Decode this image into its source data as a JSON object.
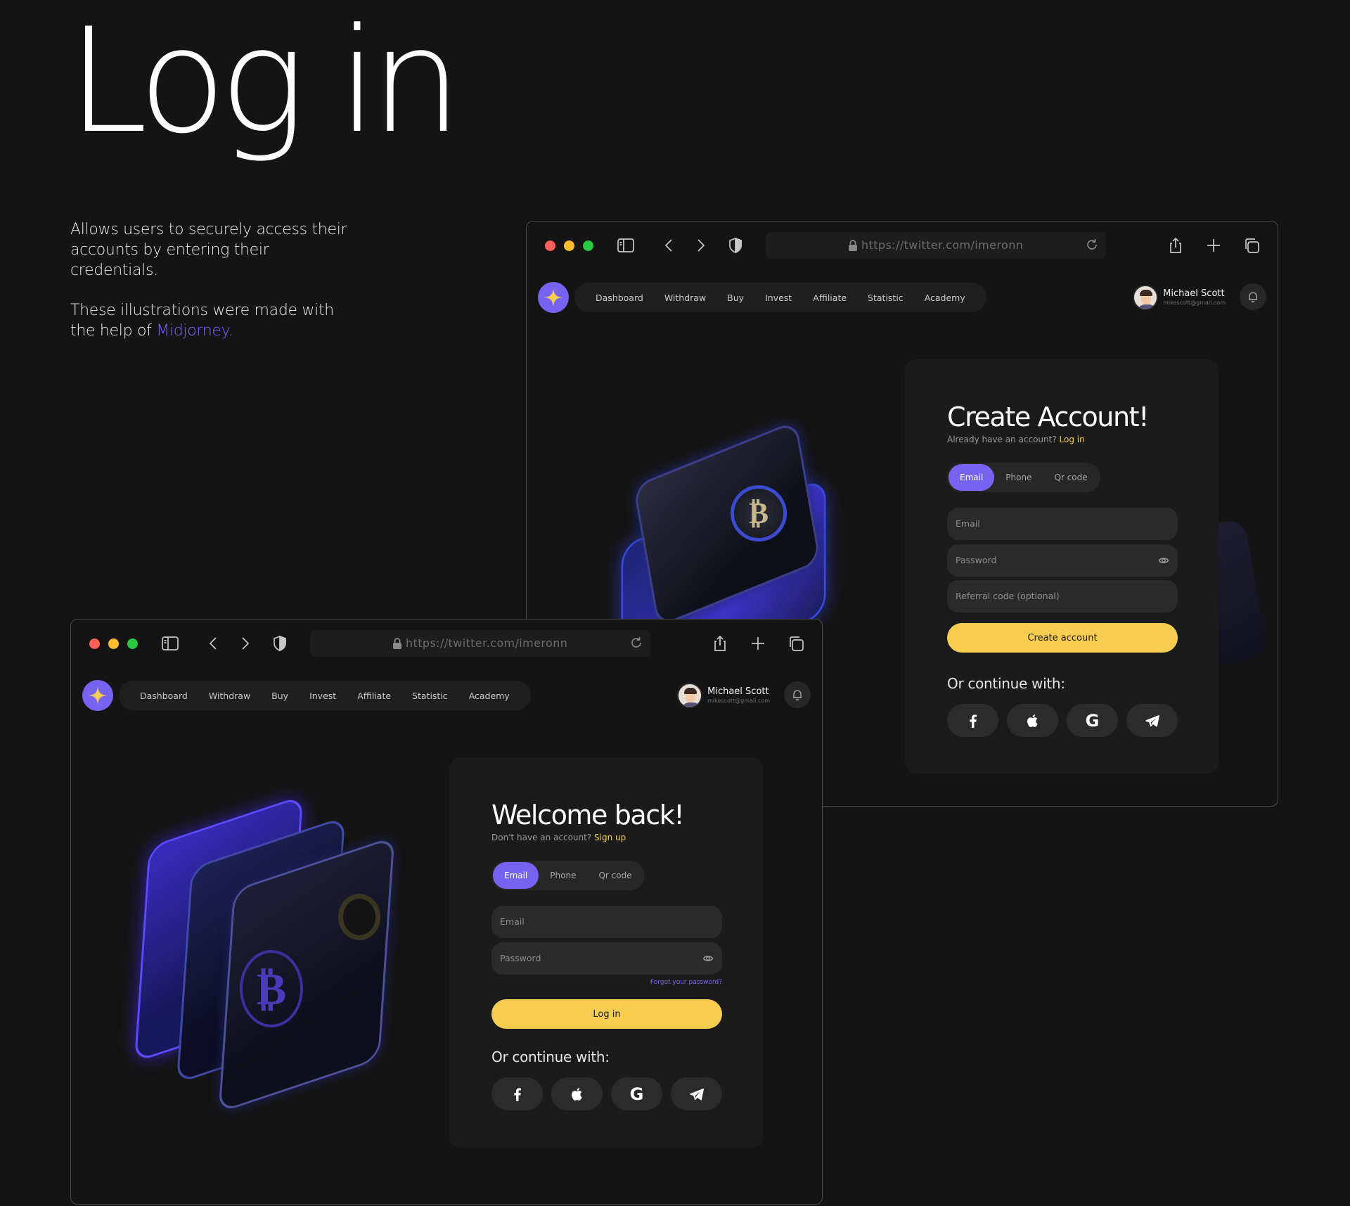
{
  "intro": {
    "title": "Log in",
    "desc": "Allows users to securely access their accounts by entering their credentials.",
    "credit_prefix": "These illustrations were made with the help of",
    "credit_link": "Midjorney."
  },
  "browser": {
    "url": "https://twitter.com/imeronn",
    "nav": [
      "Dashboard",
      "Withdraw",
      "Buy",
      "Invest",
      "Affiliate",
      "Statistic",
      "Academy"
    ],
    "user_name": "Michael Scott",
    "user_email": "mikescott@gmail.com"
  },
  "signup": {
    "title": "Create Account!",
    "subtitle": "Already have an account?",
    "subtitle_link": "Log in",
    "tabs": [
      "Email",
      "Phone",
      "Qr code"
    ],
    "active_tab": "Email",
    "email_placeholder": "Email",
    "password_placeholder": "Password",
    "referral_placeholder": "Referral code (optional)",
    "button": "Create account",
    "or_continue": "Or continue with:"
  },
  "login": {
    "title": "Welcome back!",
    "subtitle": "Don't have an account?",
    "subtitle_link": "Sign up",
    "tabs": [
      "Email",
      "Phone",
      "Qr code"
    ],
    "active_tab": "Email",
    "email_placeholder": "Email",
    "password_placeholder": "Password",
    "forgot": "Forgot your password?",
    "button": "Log in",
    "or_continue": "Or continue with:"
  },
  "social_icons": [
    "facebook-icon",
    "apple-icon",
    "google-icon",
    "telegram-icon"
  ],
  "colors": {
    "background": "#141414",
    "accent_purple": "#7663f2",
    "accent_yellow": "#f6cd50",
    "card": "#1b1b1b",
    "field": "#2a2a2a"
  }
}
